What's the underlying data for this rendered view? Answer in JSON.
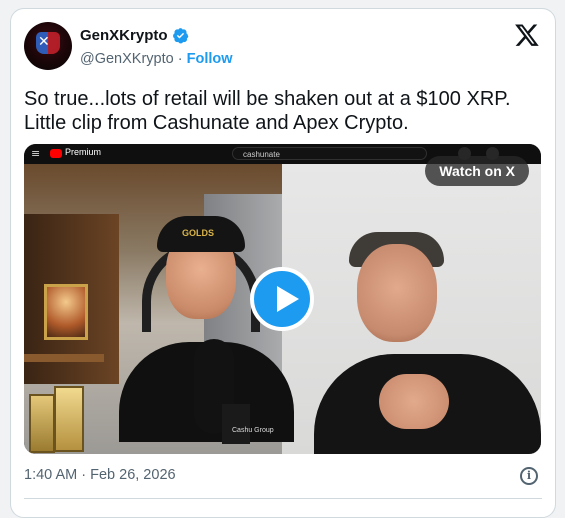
{
  "author": {
    "name": "GenXKrypto",
    "handle": "@GenXKrypto",
    "separator": "·",
    "follow_label": "Follow",
    "verified": true
  },
  "tweet_text": "So true...lots of retail will be shaken out at a $100 XRP. Little clip from Cashunate and Apex Crypto.",
  "video": {
    "watch_label": "Watch on X",
    "youtube_label": "Premium",
    "search_text": "cashunate",
    "cap_text": "GOLDS",
    "shirt_logo": "Cashu Group"
  },
  "footer": {
    "time": "1:40 AM",
    "separator": "·",
    "date": "Feb 26, 2026"
  },
  "colors": {
    "accent": "#1d9bf0",
    "text": "#0f1419",
    "muted": "#536471"
  },
  "icons": [
    "x-logo-icon",
    "verified-badge-icon",
    "play-icon",
    "info-icon"
  ]
}
